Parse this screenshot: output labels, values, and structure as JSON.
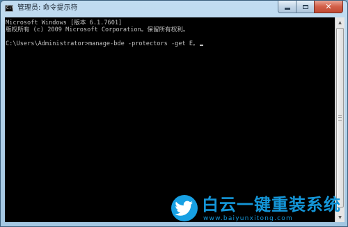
{
  "window": {
    "title": "管理员: 命令提示符",
    "icon_text": "C:\\"
  },
  "caption_buttons": {
    "minimize": "minimize",
    "maximize": "maximize",
    "close": "✕"
  },
  "console": {
    "lines": [
      "Microsoft Windows [版本 6.1.7601]",
      "版权所有 (c) 2009 Microsoft Corporation。保留所有权利。",
      "",
      "C:\\Users\\Administrator>manage-bde -protectors -get E。"
    ]
  },
  "scrollbar": {
    "up_arrow": "▲",
    "down_arrow": "▼"
  },
  "watermark": {
    "title": "白云一键重装系统",
    "url": "www.baiyunxitong.com",
    "logo_icon": "bird-icon",
    "color": "#1496d8"
  }
}
